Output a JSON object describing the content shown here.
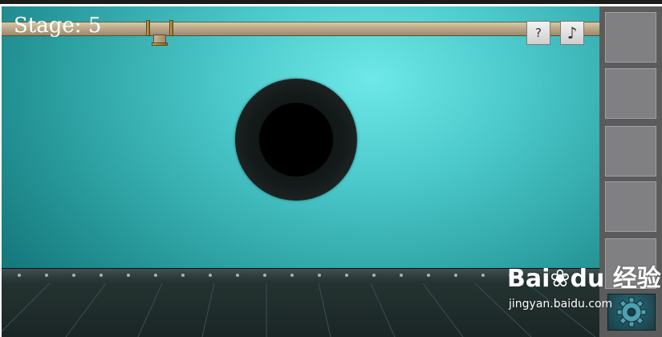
{
  "hud": {
    "stage_label": "Stage: 5",
    "help_button_label": "?",
    "music_button_label": "♪"
  },
  "icons": {
    "help": "question-mark-icon",
    "music": "music-note-icon",
    "settings": "gear-icon"
  },
  "inventory": {
    "slots": [
      "",
      "",
      "",
      "",
      ""
    ]
  },
  "watermark": {
    "logo_text": "Bai❀du 经验",
    "url": "jingyan.baidu.com"
  },
  "colors": {
    "wall": "#4cc9cb",
    "pipe": "#bba98a",
    "inventory_bg": "#5b5b5b",
    "slot_bg": "#808082",
    "floor": "#1f2b2a"
  }
}
